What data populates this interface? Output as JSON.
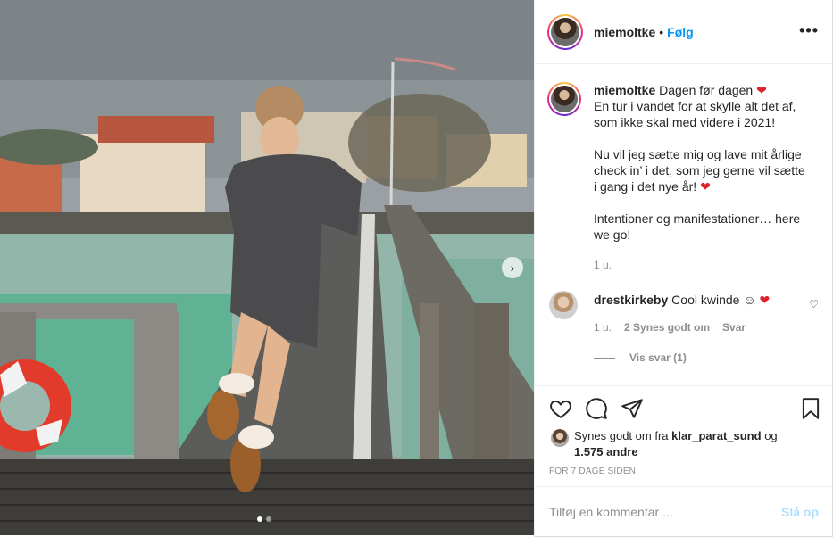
{
  "post": {
    "username": "miemoltke",
    "separator": "•",
    "follow_label": "Følg",
    "more_label": "•••",
    "caption": {
      "username": "miemoltke",
      "paragraph1": "Dagen før dagen",
      "paragraph1_rest": "En tur i vandet for at skylle alt det af, som ikke skal med videre i 2021!",
      "paragraph2": "Nu vil jeg sætte mig og lave mit årlige check in’ i det, som jeg gerne vil sætte i gang i det nye år!",
      "paragraph3": "Intentioner og manifestationer… here we go!",
      "heart": "❤",
      "time": "1 u."
    },
    "comment": {
      "username": "drestkirkeby",
      "text": "Cool kwinde ☺",
      "heart": "❤",
      "time": "1 u.",
      "likes": "2 Synes godt om",
      "reply_label": "Svar",
      "like_icon": "♡",
      "view_replies": "Vis svar (1)"
    },
    "likes": {
      "prefix": "Synes godt om fra",
      "liker": "klar_parat_sund",
      "joiner": "og",
      "others": "1.575 andre"
    },
    "date": "FOR 7 DAGE SIDEN",
    "add_comment": {
      "placeholder": "Tilføj en kommentar ...",
      "post_label": "Slå op"
    },
    "carousel": {
      "next_icon": "›",
      "slide_count": 2,
      "active_slide": 1
    }
  },
  "colors": {
    "follow": "#0095f6",
    "heart": "#e0202a",
    "muted": "#8e8e8e",
    "post_disabled": "#b2dffc"
  },
  "icons": [
    "heart-icon",
    "comment-icon",
    "share-icon",
    "bookmark-icon",
    "more-icon",
    "next-arrow-icon"
  ]
}
